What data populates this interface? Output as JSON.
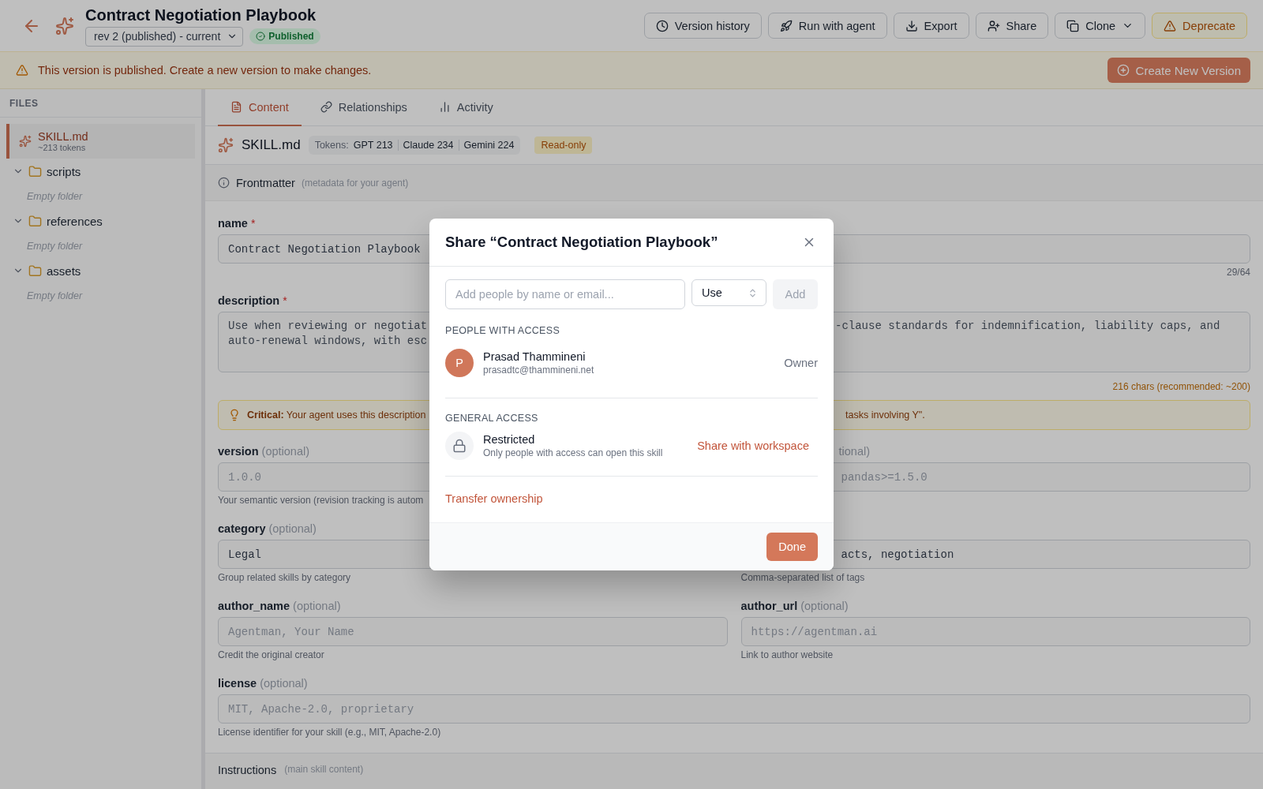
{
  "header": {
    "title": "Contract Negotiation Playbook",
    "revision": "rev 2 (published) - current",
    "status": "Published",
    "actions": [
      {
        "label": "Version history",
        "kind": "default"
      },
      {
        "label": "Run with agent",
        "kind": "default"
      },
      {
        "label": "Export",
        "kind": "default"
      },
      {
        "label": "Share",
        "kind": "default"
      },
      {
        "label": "Clone",
        "kind": "dropdown"
      },
      {
        "label": "Deprecate",
        "kind": "warning"
      }
    ]
  },
  "banner": {
    "message": "This version is published. Create a new version to make changes.",
    "action": "Create New Version"
  },
  "sidebar": {
    "heading": "FILES",
    "items": [
      {
        "kind": "file",
        "name": "SKILL.md",
        "meta": "~213 tokens",
        "selected": true
      },
      {
        "kind": "folder",
        "name": "scripts",
        "expanded": true,
        "children": [
          {
            "kind": "empty",
            "name": "Empty folder"
          }
        ]
      },
      {
        "kind": "folder",
        "name": "references",
        "expanded": true,
        "children": [
          {
            "kind": "empty",
            "name": "Empty folder"
          }
        ]
      },
      {
        "kind": "folder",
        "name": "assets",
        "expanded": true,
        "children": [
          {
            "kind": "empty",
            "name": "Empty folder"
          }
        ]
      }
    ]
  },
  "tabs": [
    {
      "label": "Content",
      "selected": true
    },
    {
      "label": "Relationships",
      "selected": false
    },
    {
      "label": "Activity",
      "selected": false
    }
  ],
  "file_bar": {
    "name": "SKILL.md",
    "tokens_label": "Tokens:",
    "tokens": [
      "GPT 213",
      "Claude 234",
      "Gemini 224"
    ],
    "badge": "Read-only"
  },
  "frontmatter": {
    "title": "Frontmatter",
    "hint": "(metadata for your agent)"
  },
  "form": {
    "name": {
      "label": "name",
      "required": "*",
      "value": "Contract Negotiation Playbook",
      "counter": "29/64",
      "counter_warning": false
    },
    "description": {
      "label": "description",
      "required": "*",
      "lines": [
        {
          "left": "Use when reviewing or negotiat",
          "right": "-clause standards for indemnification, liability caps, and"
        },
        {
          "left": "auto-renewal windows, with esc"
        }
      ],
      "counter": "216 chars (recommended: ~200)",
      "counter_warning": true
    },
    "callout": {
      "left": "**Critical:** Your agent uses this description",
      "right": "tasks involving Y\"."
    },
    "rows": [
      {
        "left": {
          "label": "version",
          "optional": "(optional)",
          "placeholder": "1.0.0",
          "help": "Your semantic version (revision tracking is autom"
        },
        "right": {
          "covered": true,
          "label_fragment": "tional)",
          "placeholder": "pandas>=1.5.0"
        }
      },
      {
        "left": {
          "label": "category",
          "optional": "(optional)",
          "value": "Legal",
          "help": "Group related skills by category"
        },
        "right": {
          "covered": true,
          "value": "acts, negotiation",
          "help": "Comma-separated list of tags"
        }
      },
      {
        "left": {
          "label": "author_name",
          "optional": "(optional)",
          "placeholder": "Agentman, Your Name",
          "help": "Credit the original creator"
        },
        "right": {
          "covered": false,
          "label": "author_url",
          "optional": "(optional)",
          "placeholder": "https://agentman.ai",
          "help": "Link to author website"
        }
      }
    ],
    "license": {
      "label": "license",
      "optional": "(optional)",
      "placeholder": "MIT, Apache-2.0, proprietary",
      "help": "License identifier for your skill (e.g., MIT, Apache-2.0)"
    }
  },
  "instructions": {
    "title": "Instructions",
    "hint": "(main skill content)"
  },
  "share_dialog": {
    "title": "Share “Contract Negotiation Playbook”",
    "invite_placeholder": "Add people by name or email...",
    "role": "Use",
    "add_button": {
      "label": "Add",
      "disabled": true
    },
    "people_heading": "PEOPLE WITH ACCESS",
    "people": [
      {
        "initial": "P",
        "name": "Prasad Thammineni",
        "email": "prasadtc@thammineni.net",
        "role": "Owner"
      }
    ],
    "general_heading": "GENERAL ACCESS",
    "access": {
      "title": "Restricted",
      "description": "Only people with access can open this skill",
      "action": "Share with workspace"
    },
    "transfer": "Transfer ownership",
    "done": "Done"
  }
}
